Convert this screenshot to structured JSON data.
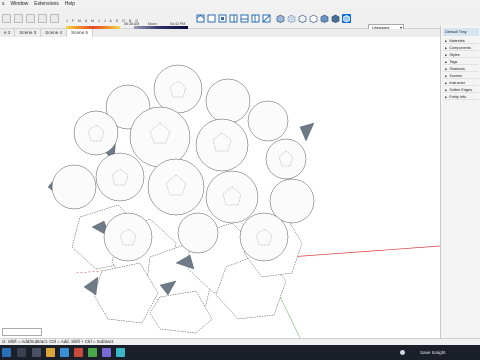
{
  "menubar": {
    "items": [
      "s",
      "Window",
      "Extensions",
      "Help"
    ]
  },
  "toolbar": {
    "month_strip": "J F M A M J J A S O N D",
    "time_a": "06:38 AM",
    "time_b": "Noon",
    "time_c": "04:42 PM",
    "tag_value": "Untagged",
    "icon_names": [
      "view-iso-icon",
      "view-top-icon",
      "view-front-icon",
      "view-right-icon",
      "view-back-icon",
      "view-left-icon",
      "view-bottom-icon",
      "xray-icon",
      "back-edges-icon",
      "wireframe-icon",
      "hidden-line-icon",
      "shaded-icon",
      "shaded-textures-icon",
      "monochrome-icon"
    ]
  },
  "tabs": [
    {
      "label": "e 2",
      "active": false
    },
    {
      "label": "Scene 3",
      "active": false
    },
    {
      "label": "Scene 4",
      "active": false
    },
    {
      "label": "Scene 5",
      "active": true
    }
  ],
  "tray": {
    "title": "Default Tray",
    "items": [
      "Materials",
      "Components",
      "Styles",
      "Tags",
      "Shadows",
      "Scenes",
      "Instructor",
      "Soften Edges",
      "Entity Info"
    ]
  },
  "statusbar": {
    "text": "ct. Shift = Add/Subtract. Ctrl = Add. Shift + Ctrl = Subtract."
  },
  "taskbar": {
    "save_text": "Save tonight"
  },
  "colors": {
    "red_axis": "#d63b3b",
    "green_axis": "#7cbf6a",
    "taskbar": "#1b1f2a",
    "accent": "#0a6bd6"
  }
}
